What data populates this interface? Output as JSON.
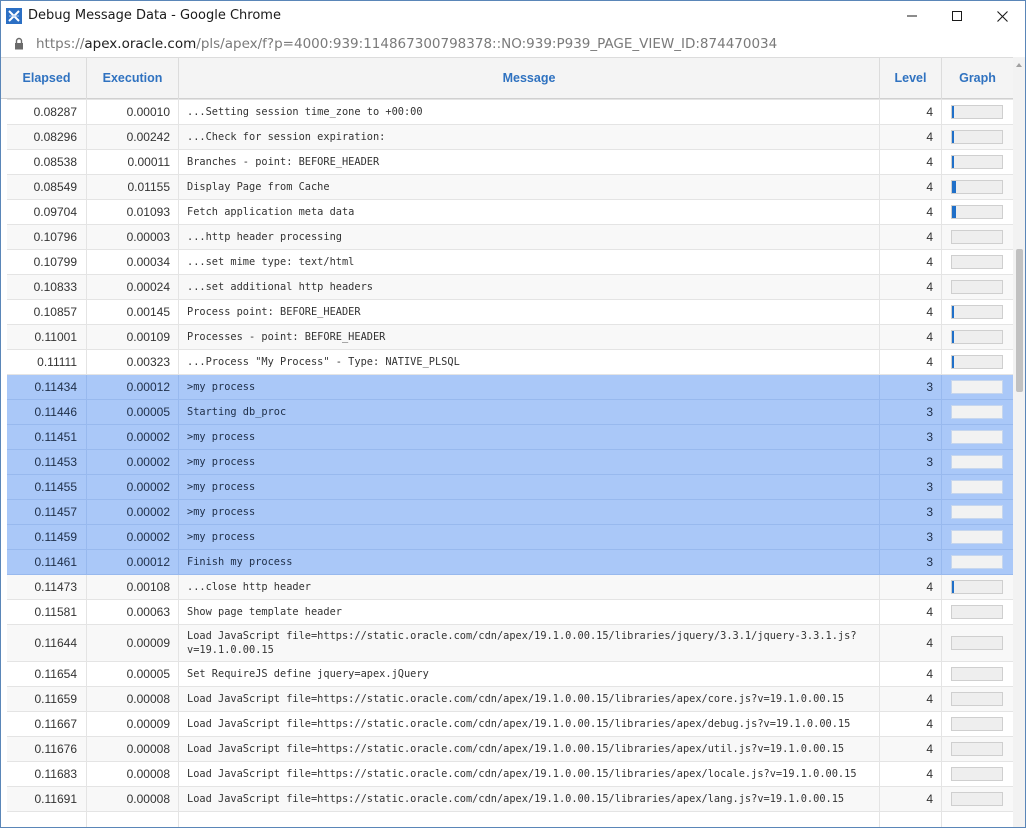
{
  "window": {
    "title": "Debug Message Data - Google Chrome"
  },
  "address": {
    "scheme": "https://",
    "domain": "apex.oracle.com",
    "path": "/pls/apex/f?p=4000:939:114867300798378::NO:939:P939_PAGE_VIEW_ID:874470034"
  },
  "icons": {
    "app": "apex-logo-icon",
    "lock": "lock-icon",
    "minimize": "minimize-icon",
    "maximize": "maximize-icon",
    "close": "close-icon"
  },
  "colors": {
    "header_text": "#2f72c0",
    "selected_row": "#aac8f8",
    "bar_fill": "#1f6fc8"
  },
  "table": {
    "headers": {
      "elapsed": "Elapsed",
      "execution": "Execution",
      "message": "Message",
      "level": "Level",
      "graph": "Graph"
    },
    "rows": [
      {
        "elapsed": "0.08287",
        "execution": "0.00010",
        "message": "...Setting session time_zone to +00:00",
        "level": "4",
        "graph_fraction": 0.01,
        "selected": false
      },
      {
        "elapsed": "0.08296",
        "execution": "0.00242",
        "message": "...Check for session expiration:",
        "level": "4",
        "graph_fraction": 0.02,
        "selected": false
      },
      {
        "elapsed": "0.08538",
        "execution": "0.00011",
        "message": "Branches - point: BEFORE_HEADER",
        "level": "4",
        "graph_fraction": 0.01,
        "selected": false
      },
      {
        "elapsed": "0.08549",
        "execution": "0.01155",
        "message": "Display Page from Cache",
        "level": "4",
        "graph_fraction": 0.08,
        "selected": false
      },
      {
        "elapsed": "0.09704",
        "execution": "0.01093",
        "message": "Fetch application meta data",
        "level": "4",
        "graph_fraction": 0.08,
        "selected": false
      },
      {
        "elapsed": "0.10796",
        "execution": "0.00003",
        "message": "...http header processing",
        "level": "4",
        "graph_fraction": 0.0,
        "selected": false
      },
      {
        "elapsed": "0.10799",
        "execution": "0.00034",
        "message": "...set mime type: text/html",
        "level": "4",
        "graph_fraction": 0.0,
        "selected": false
      },
      {
        "elapsed": "0.10833",
        "execution": "0.00024",
        "message": "...set additional http headers",
        "level": "4",
        "graph_fraction": 0.0,
        "selected": false
      },
      {
        "elapsed": "0.10857",
        "execution": "0.00145",
        "message": "Process point: BEFORE_HEADER",
        "level": "4",
        "graph_fraction": 0.01,
        "selected": false
      },
      {
        "elapsed": "0.11001",
        "execution": "0.00109",
        "message": "Processes - point: BEFORE_HEADER",
        "level": "4",
        "graph_fraction": 0.01,
        "selected": false
      },
      {
        "elapsed": "0.11111",
        "execution": "0.00323",
        "message": "...Process \"My Process\" - Type: NATIVE_PLSQL",
        "level": "4",
        "graph_fraction": 0.02,
        "selected": false
      },
      {
        "elapsed": "0.11434",
        "execution": "0.00012",
        "message": ">my process",
        "level": "3",
        "graph_fraction": 0.0,
        "selected": true
      },
      {
        "elapsed": "0.11446",
        "execution": "0.00005",
        "message": "Starting db_proc",
        "level": "3",
        "graph_fraction": 0.0,
        "selected": true
      },
      {
        "elapsed": "0.11451",
        "execution": "0.00002",
        "message": ">my process",
        "level": "3",
        "graph_fraction": 0.0,
        "selected": true
      },
      {
        "elapsed": "0.11453",
        "execution": "0.00002",
        "message": ">my process",
        "level": "3",
        "graph_fraction": 0.0,
        "selected": true
      },
      {
        "elapsed": "0.11455",
        "execution": "0.00002",
        "message": ">my process",
        "level": "3",
        "graph_fraction": 0.0,
        "selected": true
      },
      {
        "elapsed": "0.11457",
        "execution": "0.00002",
        "message": ">my process",
        "level": "3",
        "graph_fraction": 0.0,
        "selected": true
      },
      {
        "elapsed": "0.11459",
        "execution": "0.00002",
        "message": ">my process",
        "level": "3",
        "graph_fraction": 0.0,
        "selected": true
      },
      {
        "elapsed": "0.11461",
        "execution": "0.00012",
        "message": "Finish my process",
        "level": "3",
        "graph_fraction": 0.0,
        "selected": true
      },
      {
        "elapsed": "0.11473",
        "execution": "0.00108",
        "message": "...close http header",
        "level": "4",
        "graph_fraction": 0.01,
        "selected": false
      },
      {
        "elapsed": "0.11581",
        "execution": "0.00063",
        "message": "Show page template header",
        "level": "4",
        "graph_fraction": 0.0,
        "selected": false
      },
      {
        "elapsed": "0.11644",
        "execution": "0.00009",
        "message": "Load JavaScript file=https://static.oracle.com/cdn/apex/19.1.0.00.15/libraries/jquery/3.3.1/jquery-3.3.1.js?v=19.1.0.00.15",
        "level": "4",
        "graph_fraction": 0.0,
        "selected": false
      },
      {
        "elapsed": "0.11654",
        "execution": "0.00005",
        "message": "Set RequireJS define jquery=apex.jQuery",
        "level": "4",
        "graph_fraction": 0.0,
        "selected": false
      },
      {
        "elapsed": "0.11659",
        "execution": "0.00008",
        "message": "Load JavaScript file=https://static.oracle.com/cdn/apex/19.1.0.00.15/libraries/apex/core.js?v=19.1.0.00.15",
        "level": "4",
        "graph_fraction": 0.0,
        "selected": false
      },
      {
        "elapsed": "0.11667",
        "execution": "0.00009",
        "message": "Load JavaScript file=https://static.oracle.com/cdn/apex/19.1.0.00.15/libraries/apex/debug.js?v=19.1.0.00.15",
        "level": "4",
        "graph_fraction": 0.0,
        "selected": false
      },
      {
        "elapsed": "0.11676",
        "execution": "0.00008",
        "message": "Load JavaScript file=https://static.oracle.com/cdn/apex/19.1.0.00.15/libraries/apex/util.js?v=19.1.0.00.15",
        "level": "4",
        "graph_fraction": 0.0,
        "selected": false
      },
      {
        "elapsed": "0.11683",
        "execution": "0.00008",
        "message": "Load JavaScript file=https://static.oracle.com/cdn/apex/19.1.0.00.15/libraries/apex/locale.js?v=19.1.0.00.15",
        "level": "4",
        "graph_fraction": 0.0,
        "selected": false
      },
      {
        "elapsed": "0.11691",
        "execution": "0.00008",
        "message": "Load JavaScript file=https://static.oracle.com/cdn/apex/19.1.0.00.15/libraries/apex/lang.js?v=19.1.0.00.15",
        "level": "4",
        "graph_fraction": 0.0,
        "selected": false
      }
    ]
  }
}
